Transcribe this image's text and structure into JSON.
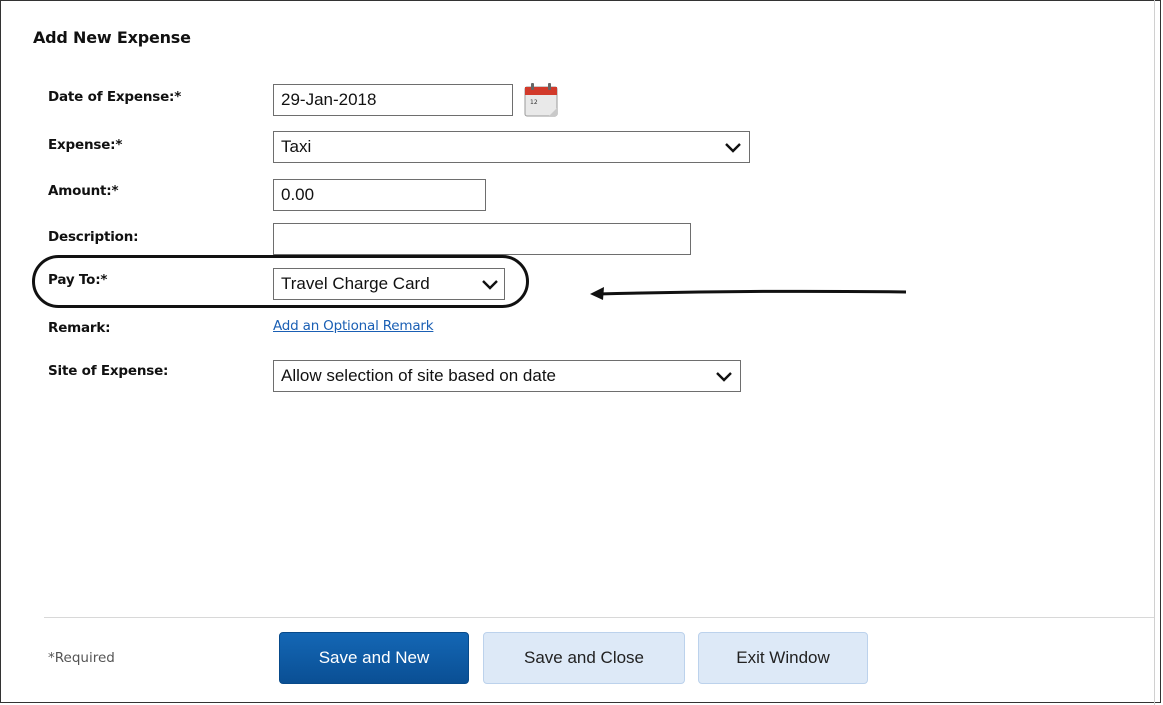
{
  "dialog": {
    "title": "Add New Expense"
  },
  "form": {
    "date": {
      "label": "Date of Expense:*",
      "value": "29-Jan-2018",
      "icon": "calendar-icon"
    },
    "expense": {
      "label": "Expense:*",
      "value": "Taxi"
    },
    "amount": {
      "label": "Amount:*",
      "value": "0.00"
    },
    "description": {
      "label": "Description:",
      "value": ""
    },
    "pay_to": {
      "label": "Pay To:*",
      "value": "Travel Charge Card"
    },
    "remark": {
      "label": "Remark:",
      "link": "Add an Optional Remark"
    },
    "site": {
      "label": "Site of Expense:",
      "value": "Allow selection of site based on date"
    }
  },
  "footer": {
    "required_note": "*Required",
    "save_new": "Save and New",
    "save_close": "Save and Close",
    "exit": "Exit Window"
  },
  "colors": {
    "primary_button": "#0b5aa6",
    "secondary_button": "#dde9f7",
    "link": "#1a5fb4"
  }
}
